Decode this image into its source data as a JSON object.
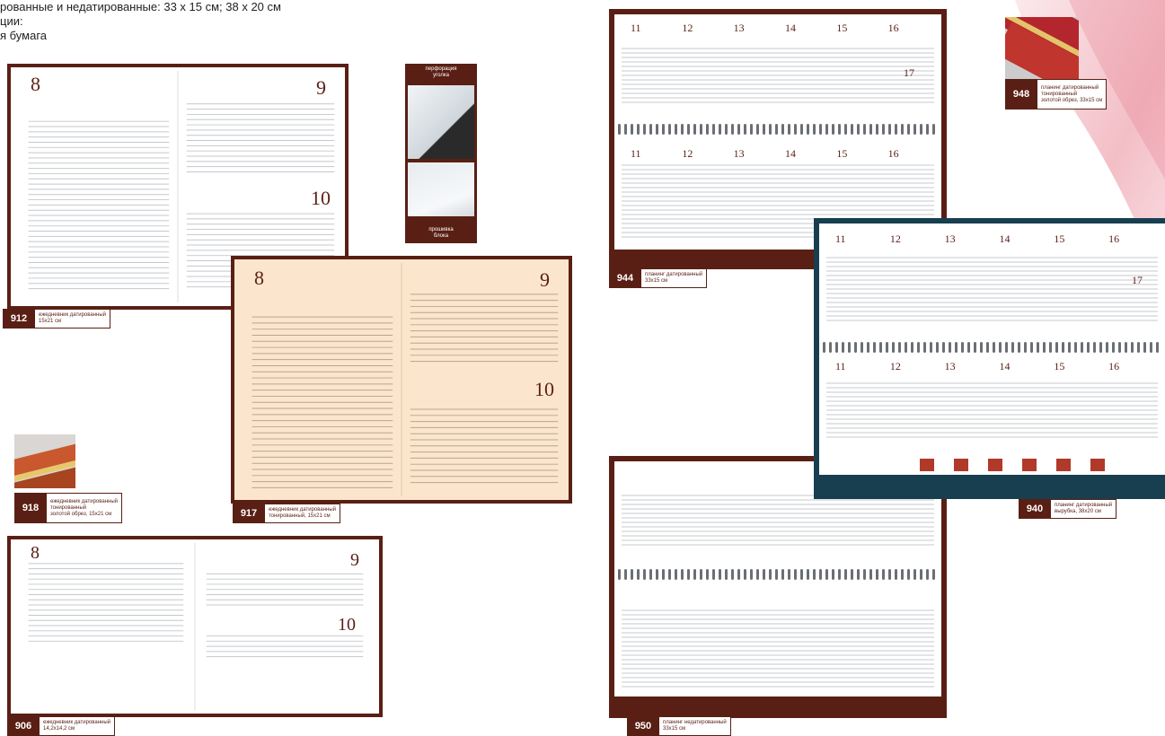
{
  "intro": {
    "line1": "рованные и недатированные: 33 х 15 см; 38 х 20 см",
    "line2": "ции:",
    "line3": "я бумага"
  },
  "colors": {
    "brown": "#5a1f14",
    "tan": "#fbe6cd",
    "teal": "#173f50",
    "red": "#b0392a",
    "rule": "#c4c8cc"
  },
  "perf_card": {
    "top_caption_1": "перфорация",
    "top_caption_2": "уголка",
    "bottom_caption_1": "прошивка",
    "bottom_caption_2": "блока"
  },
  "products": {
    "p912": {
      "code": "912",
      "desc_line1": "ежедневник датированный",
      "desc_line2": "15х21 см",
      "day_left": "8",
      "day_right_top": "9",
      "day_right_bottom": "10"
    },
    "p917": {
      "code": "917",
      "desc_line1": "ежедневник датированный",
      "desc_line2": "тонированный, 15х21 см",
      "day_left": "8",
      "day_right_top": "9",
      "day_right_bottom": "10"
    },
    "p918": {
      "code": "918",
      "desc_line1": "ежедневник датированный",
      "desc_line2": "тонированный",
      "desc_line3": "золотой обрез, 15х21 см"
    },
    "p906": {
      "code": "906",
      "desc_line1": "ежедневник датированный",
      "desc_line2": "14,2х14,2 см",
      "day_left": "8",
      "day_right_top": "9",
      "day_right_bottom": "10"
    },
    "p944": {
      "code": "944",
      "desc_line1": "планинг датированный",
      "desc_line2": "33х15 см",
      "days": [
        "11",
        "12",
        "13",
        "14",
        "15",
        "16"
      ],
      "day_extra": "17"
    },
    "p948": {
      "code": "948",
      "desc_line1": "планинг датированный",
      "desc_line2": "тонированный",
      "desc_line3": "золотой обрез, 33х15 см"
    },
    "p940": {
      "code": "940",
      "desc_line1": "планинг датированный",
      "desc_line2": "вырубка, 38х20 см",
      "days": [
        "11",
        "12",
        "13",
        "14",
        "15",
        "16"
      ],
      "day_extra": "17"
    },
    "p950": {
      "code": "950",
      "desc_line1": "планинг недатированный",
      "desc_line2": "33х15 см"
    }
  }
}
